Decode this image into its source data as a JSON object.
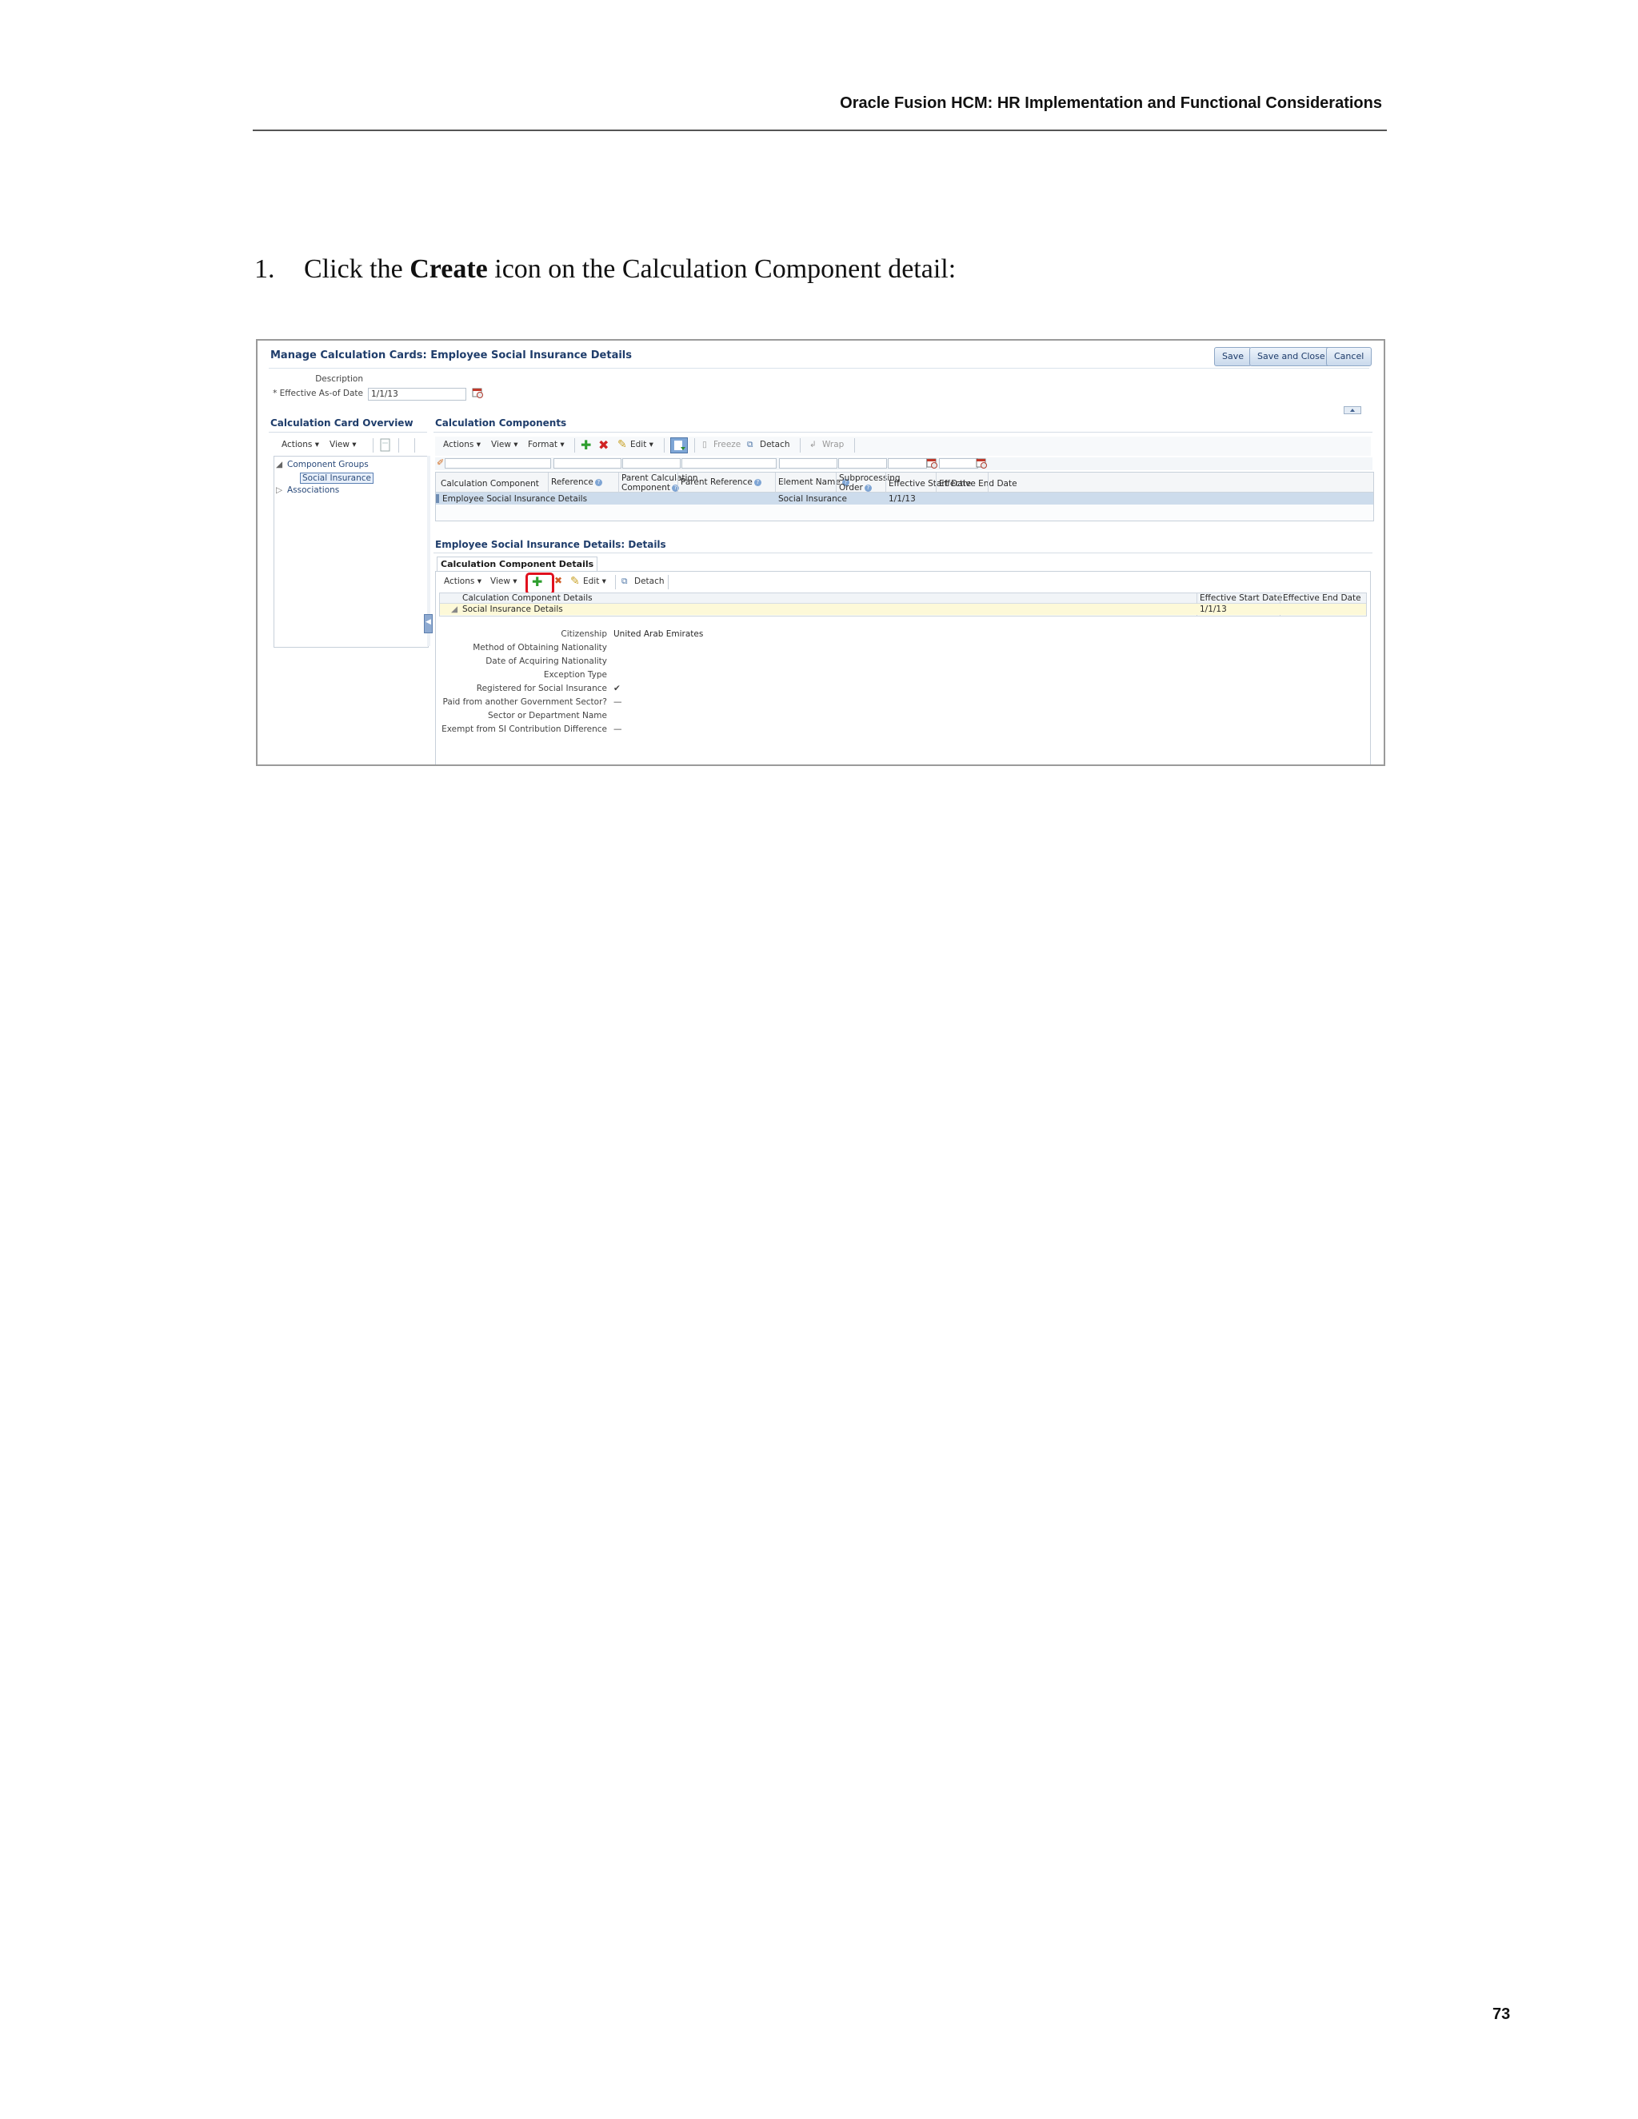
{
  "document": {
    "header_title": "Oracle Fusion HCM: HR Implementation and Functional Considerations",
    "page_number": "73",
    "step_number": "1.",
    "step_text_before": "Click the ",
    "step_text_bold": "Create",
    "step_text_after": " icon on the Calculation Component detail:"
  },
  "screen": {
    "page_title": "Manage Calculation Cards: Employee Social Insurance Details",
    "buttons": {
      "save": "Save",
      "save_close": "Save and Close",
      "cancel": "Cancel"
    },
    "description_label": "Description",
    "effective_date_label": "* Effective As-of Date",
    "effective_date_value": "1/1/13",
    "overview": {
      "title": "Calculation Card Overview",
      "toolbar": {
        "actions": "Actions ▾",
        "view": "View ▾"
      },
      "tree": {
        "component_groups": "Component Groups",
        "social_insurance": "Social Insurance",
        "associations": "Associations"
      }
    },
    "components": {
      "title": "Calculation Components",
      "toolbar": {
        "actions": "Actions ▾",
        "view": "View ▾",
        "format": "Format ▾",
        "edit": "Edit ▾",
        "freeze": "Freeze",
        "detach": "Detach",
        "wrap": "Wrap"
      },
      "columns": {
        "calc_component": "Calculation Component",
        "reference": "Reference",
        "parent_calc_line1": "Parent Calculation",
        "parent_calc_line2": "Component",
        "parent_reference": "Parent Reference",
        "element_name": "Element Name",
        "subprocessing_line1": "Subprocessing",
        "subprocessing_line2": "Order",
        "effective_start": "Effective Start Date",
        "effective_end": "Effective End Date"
      },
      "row": {
        "calc_component": "Employee Social Insurance Details",
        "element_name": "Social Insurance",
        "effective_start": "1/1/13"
      }
    },
    "details": {
      "title": "Employee Social Insurance Details: Details",
      "tab": "Calculation Component Details",
      "toolbar": {
        "actions": "Actions ▾",
        "view": "View ▾",
        "edit": "Edit ▾",
        "detach": "Detach"
      },
      "columns": {
        "name": "Calculation Component Details",
        "effective_start": "Effective Start Date",
        "effective_end": "Effective End Date"
      },
      "row": {
        "name": "Social Insurance Details",
        "effective_start": "1/1/13"
      },
      "form": {
        "citizenship_label": "Citizenship",
        "citizenship_value": "United Arab Emirates",
        "method_label": "Method of Obtaining Nationality",
        "date_label": "Date of Acquiring Nationality",
        "exception_label": "Exception Type",
        "registered_label": "Registered for Social Insurance",
        "registered_value": "✔",
        "paid_label": "Paid from another Government Sector?",
        "paid_value": "—",
        "sector_label": "Sector or Department Name",
        "exempt_label": "Exempt from SI Contribution Difference",
        "exempt_value": "—"
      }
    }
  }
}
